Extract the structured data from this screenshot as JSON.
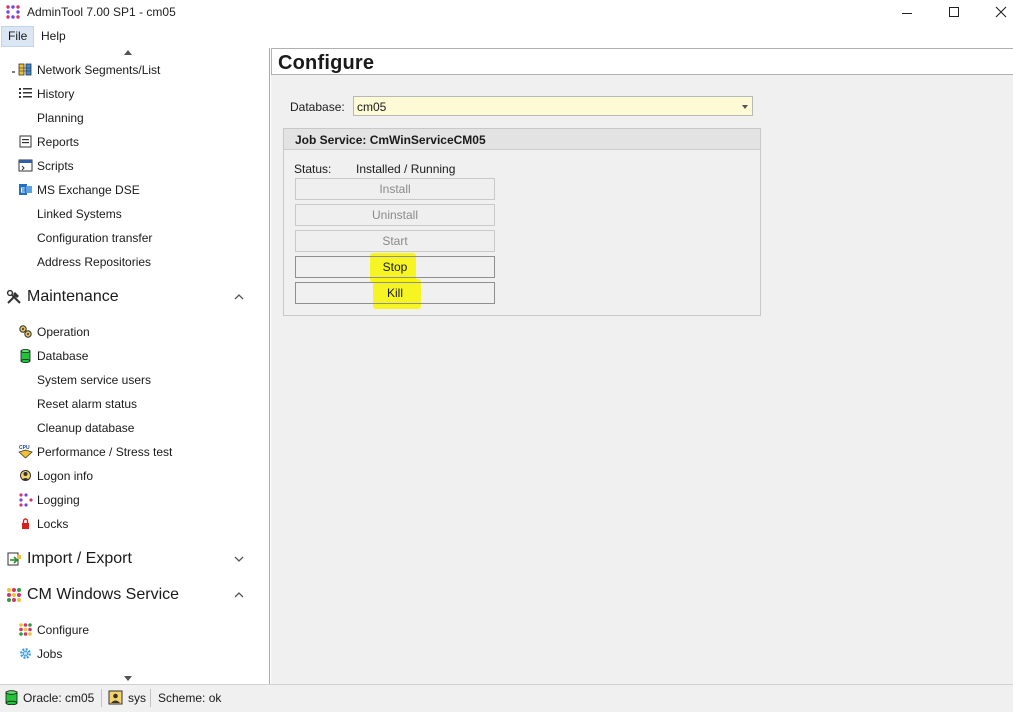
{
  "window": {
    "title": "AdminTool 7.00 SP1 - cm05"
  },
  "menu": {
    "file": "File",
    "help": "Help"
  },
  "sidebar": {
    "items_top": [
      {
        "label": "Network Segments/List",
        "icon": "network-segments-icon"
      },
      {
        "label": "History",
        "icon": "history-list-icon"
      },
      {
        "label": "Planning",
        "icon": ""
      },
      {
        "label": "Reports",
        "icon": "reports-icon"
      },
      {
        "label": "Scripts",
        "icon": "scripts-icon"
      },
      {
        "label": "MS Exchange DSE",
        "icon": "exchange-icon"
      },
      {
        "label": "Linked Systems",
        "icon": ""
      },
      {
        "label": "Configuration transfer",
        "icon": ""
      },
      {
        "label": "Address Repositories",
        "icon": ""
      }
    ],
    "maintenance": {
      "title": "Maintenance",
      "expanded": true,
      "items": [
        {
          "label": "Operation",
          "icon": "gears-icon"
        },
        {
          "label": "Database",
          "icon": "database-icon"
        },
        {
          "label": "System service users",
          "icon": ""
        },
        {
          "label": "Reset alarm status",
          "icon": ""
        },
        {
          "label": "Cleanup database",
          "icon": ""
        },
        {
          "label": "Performance / Stress test",
          "icon": "cpu-icon"
        },
        {
          "label": "Logon info",
          "icon": "logon-icon"
        },
        {
          "label": "Logging",
          "icon": "logging-icon"
        },
        {
          "label": "Locks",
          "icon": "lock-icon"
        }
      ]
    },
    "import_export": {
      "title": "Import / Export",
      "expanded": false
    },
    "cm_windows_service": {
      "title": "CM Windows Service",
      "expanded": true,
      "items": [
        {
          "label": "Configure",
          "icon": "configure-icon"
        },
        {
          "label": "Jobs",
          "icon": "jobs-gear-icon"
        }
      ]
    }
  },
  "main": {
    "title": "Configure",
    "database_label": "Database:",
    "database_value": "cm05",
    "job_service": {
      "title": "Job Service: CmWinServiceCM05",
      "status_label": "Status:",
      "status_value": "Installed / Running",
      "buttons": {
        "install": "Install",
        "uninstall": "Uninstall",
        "start": "Start",
        "stop": "Stop",
        "kill": "Kill"
      }
    }
  },
  "statusbar": {
    "connection": "Oracle: cm05",
    "user": "sys",
    "scheme": "Scheme: ok"
  },
  "colors": {
    "highlight": "#f8f400",
    "input_bg": "#fdfbd6",
    "panel_bg": "#f0f0f0"
  }
}
